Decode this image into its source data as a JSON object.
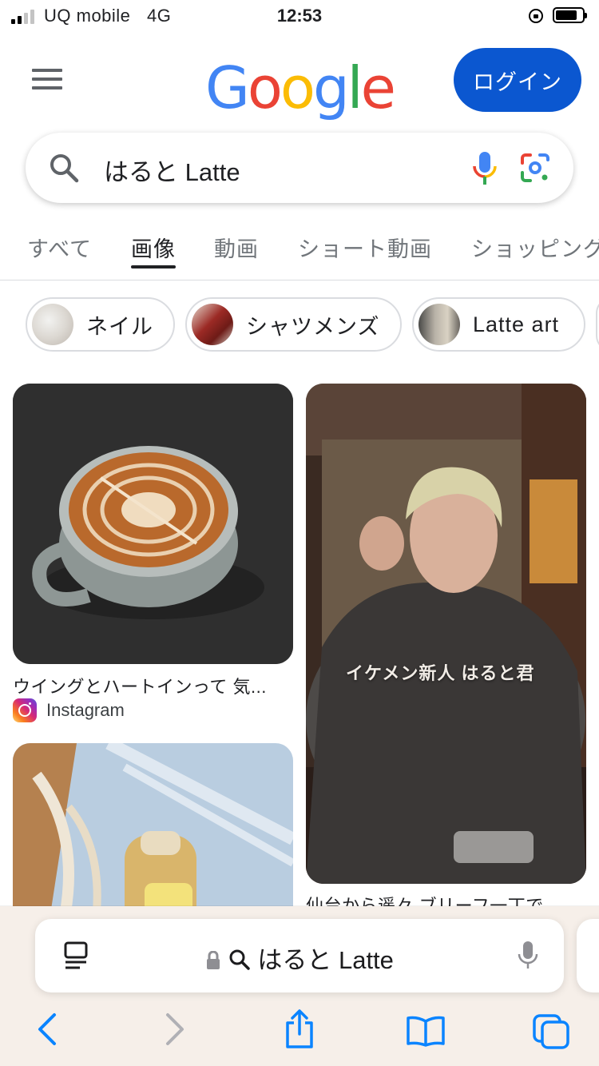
{
  "status_bar": {
    "carrier": "UQ mobile",
    "network": "4G",
    "time": "12:53"
  },
  "header": {
    "logo_letters": [
      "G",
      "o",
      "o",
      "g",
      "l",
      "e"
    ],
    "login_label": "ログイン"
  },
  "search": {
    "query": "はると Latte"
  },
  "tabs": [
    "すべて",
    "画像",
    "動画",
    "ショート動画",
    "ショッピング"
  ],
  "active_tab": "画像",
  "chips": [
    "ネイル",
    "シャツメンズ",
    "Latte art"
  ],
  "results": [
    {
      "caption": "ウイングとハートインって 気...",
      "source": "Instagram"
    },
    {
      "caption": "仙台から遥々 ブリーフ一丁で...",
      "overlay_text": "イケメン新人 はると君"
    }
  ],
  "safari": {
    "address_text": "はると Latte"
  },
  "colors": {
    "accent_blue": "#0b57d0",
    "ios_blue": "#0a84ff",
    "toolbar_bg": "#f6efe9"
  }
}
